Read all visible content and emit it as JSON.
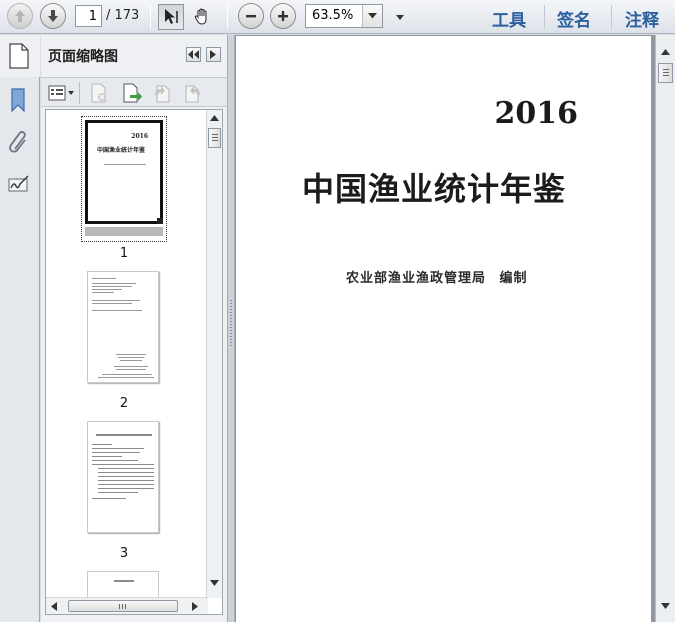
{
  "toolbar": {
    "current_page": "1",
    "total_pages": "/ 173",
    "zoom": "63.5%",
    "menu": {
      "tools": "工具",
      "sign": "签名",
      "comment": "注释"
    }
  },
  "thumbnails_panel": {
    "title": "页面缩略图",
    "pages": [
      {
        "number": "1"
      },
      {
        "number": "2"
      },
      {
        "number": "3"
      }
    ],
    "selected_page": "1"
  },
  "thumbnail_page1": {
    "year": "2016",
    "title": "中国渔业统计年鉴"
  },
  "document": {
    "year": "2016",
    "title": "中国渔业统计年鉴",
    "publisher": "农业部渔业渔政管理局 编制"
  },
  "colors": {
    "menu_text": "#2b5f9e",
    "toolbar_bg": "#e6eaf0",
    "doc_bg": "#9097a1"
  }
}
